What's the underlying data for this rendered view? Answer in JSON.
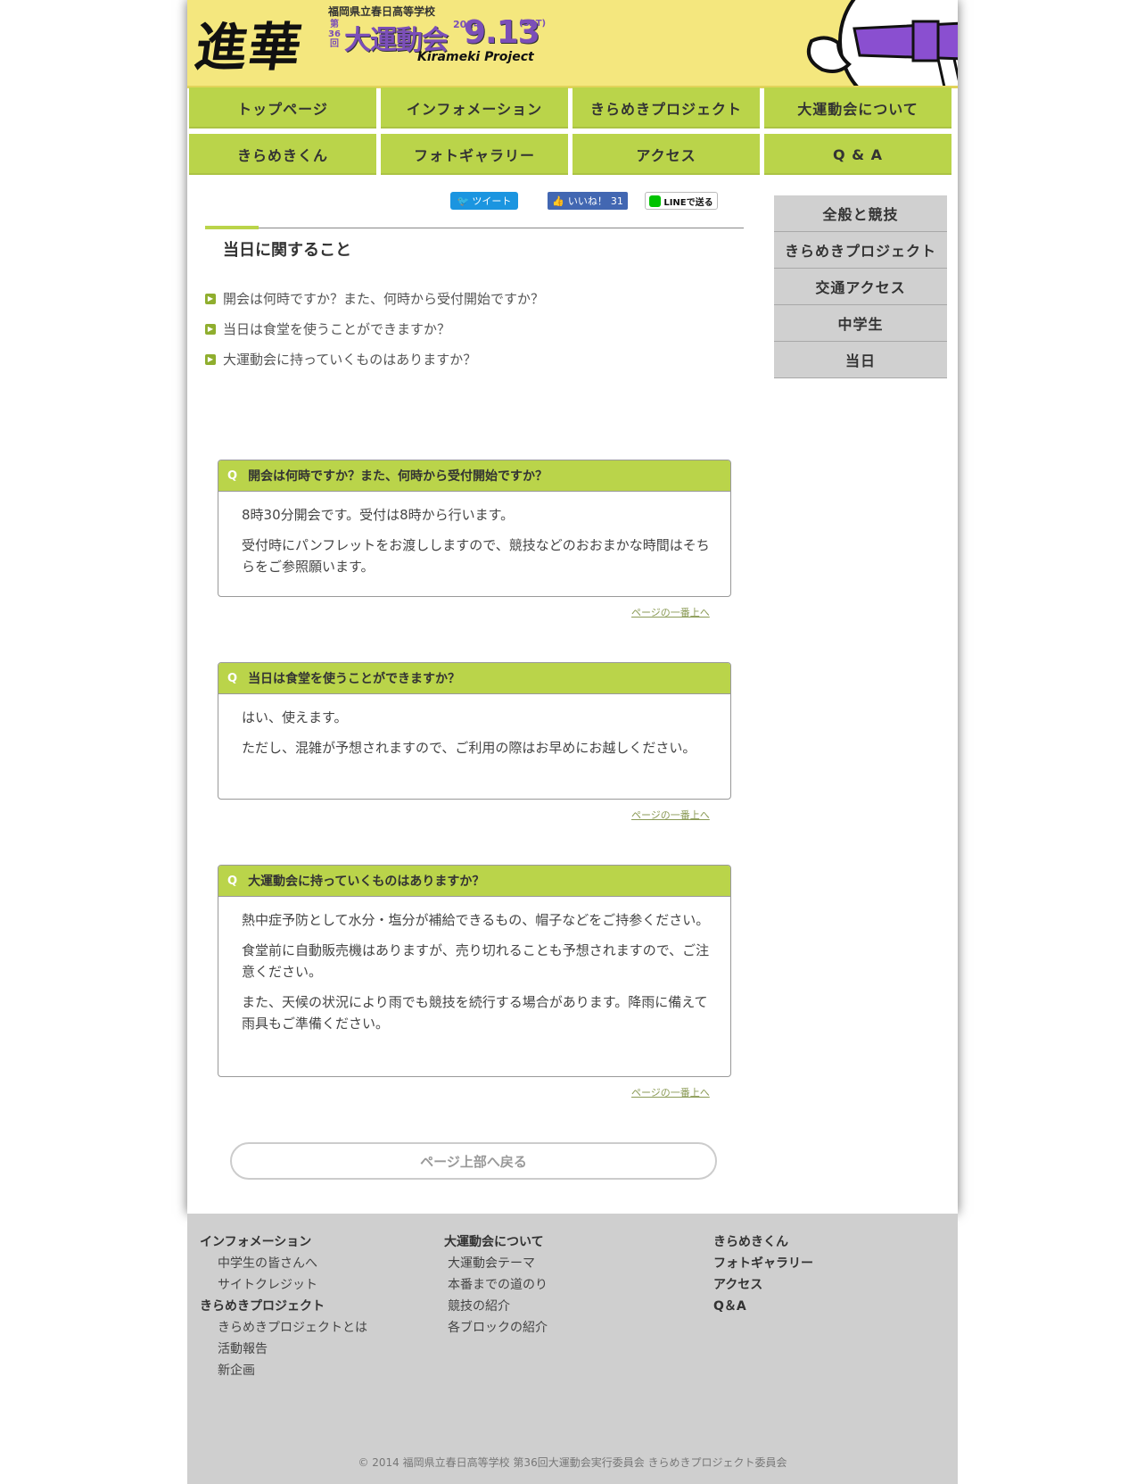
{
  "header": {
    "logo_text": "進華",
    "school": "福岡県立春日高等学校",
    "edition": "第36回",
    "event": "大運動会",
    "year": "2014",
    "date": "9.13",
    "weekday": "(SAT)",
    "project": "Kirameki Project"
  },
  "nav": [
    "トップページ",
    "インフォメーション",
    "きらめきプロジェクト",
    "大運動会について",
    "きらめきくん",
    "フォトギャラリー",
    "アクセス",
    "Q & A"
  ],
  "share": {
    "tweet": "ツイート",
    "like": "いいね！",
    "like_count": "31",
    "line": "LINEで送る"
  },
  "section": {
    "title": "当日に関すること",
    "toc": [
      "開会は何時ですか？また、何時から受付開始ですか？",
      "当日は食堂を使うことができますか？",
      "大運動会に持っていくものはありますか？"
    ]
  },
  "qa": [
    {
      "q_mark": "Q",
      "question": "開会は何時ですか？また、何時から受付開始ですか？",
      "answers": [
        "8時30分開会です。受付は8時から行います。",
        "受付時にパンフレットをお渡ししますので、競技などのおおまかな時間はそちらをご参照願います。"
      ],
      "to_top": "ページの一番上へ"
    },
    {
      "q_mark": "Q",
      "question": "当日は食堂を使うことができますか？",
      "answers": [
        "はい、使えます。",
        "ただし、混雑が予想されますので、ご利用の際はお早めにお越しください。"
      ],
      "to_top": "ページの一番上へ"
    },
    {
      "q_mark": "Q",
      "question": "大運動会に持っていくものはありますか？",
      "answers": [
        "熱中症予防として水分・塩分が補給できるもの、帽子などをご持参ください。",
        "食堂前に自動販売機はありますが、売り切れることも予想されますので、ご注意ください。",
        "また、天候の状況により雨でも競技を続行する場合があります。降雨に備えて雨具もご準備ください。"
      ],
      "to_top": "ページの一番上へ"
    }
  ],
  "back_to_top": "ページ上部へ戻る",
  "sidebar": [
    "全般と競技",
    "きらめきプロジェクト",
    "交通アクセス",
    "中学生",
    "当日"
  ],
  "footer": {
    "col1": [
      {
        "head": "インフォメーション",
        "subs": [
          "中学生の皆さんへ",
          "サイトクレジット"
        ]
      },
      {
        "head": "きらめきプロジェクト",
        "subs": [
          "きらめきプロジェクトとは",
          "活動報告",
          "新企画"
        ]
      }
    ],
    "col2": [
      {
        "head": "大運動会について",
        "subs": [
          "大運動会テーマ",
          "本番までの道のり",
          "競技の紹介",
          "各ブロックの紹介"
        ]
      }
    ],
    "col3": [
      "きらめきくん",
      "フォトギャラリー",
      "アクセス",
      "Q＆A"
    ],
    "copyright": "© 2014 福岡県立春日高等学校 第36回大運動会実行委員会 きらめきプロジェクト委員会"
  },
  "colors": {
    "header_bg": "#f4e77e",
    "nav_green": "#bad44a",
    "accent_purple": "#7b4fb8",
    "sidebar_gray": "#d0d0d0",
    "footer_gray": "#cfcfcf"
  }
}
